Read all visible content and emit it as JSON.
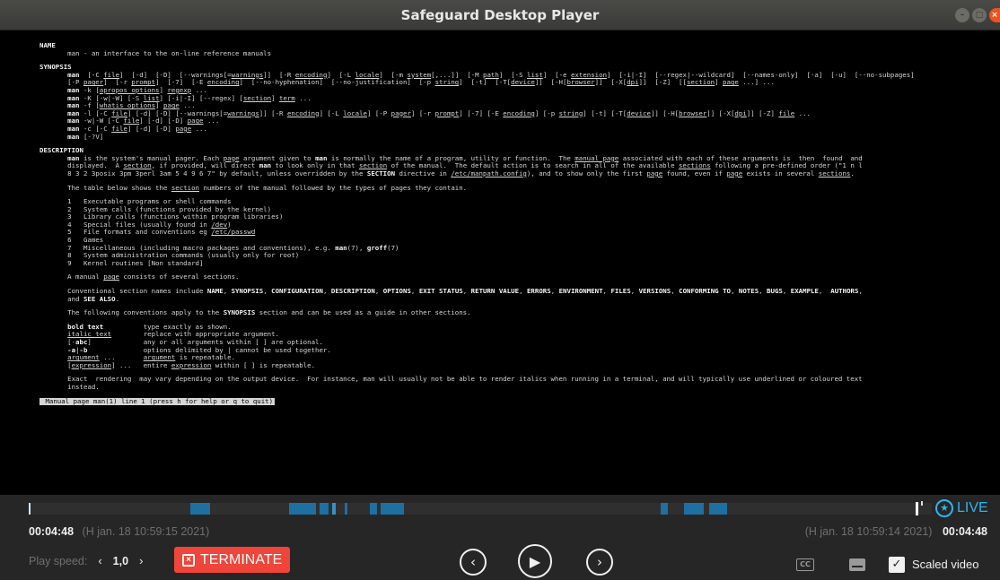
{
  "window": {
    "title": "Safeguard Desktop Player"
  },
  "terminal": {
    "lines": [
      [
        {
          "t": "NAME",
          "c": "b"
        }
      ],
      [
        {
          "t": "       man - an interface to the on-line reference manuals"
        }
      ],
      [],
      [
        {
          "t": "SYNOPSIS",
          "c": "b"
        }
      ],
      [
        {
          "t": "       "
        },
        {
          "t": "man",
          "c": "b"
        },
        {
          "t": "  [-C "
        },
        {
          "t": "file",
          "c": "u"
        },
        {
          "t": "]  [-d]  [-D]  [--warnings[="
        },
        {
          "t": "warnings",
          "c": "u"
        },
        {
          "t": "]]  [-R "
        },
        {
          "t": "encoding",
          "c": "u"
        },
        {
          "t": "]  [-L "
        },
        {
          "t": "locale",
          "c": "u"
        },
        {
          "t": "]  [-m "
        },
        {
          "t": "system",
          "c": "u"
        },
        {
          "t": "[,...]]  [-M "
        },
        {
          "t": "path",
          "c": "u"
        },
        {
          "t": "]  [-S "
        },
        {
          "t": "list",
          "c": "u"
        },
        {
          "t": "]  [-e "
        },
        {
          "t": "extension",
          "c": "u"
        },
        {
          "t": "]  [-i|-I]  [--regex|--wildcard]  [--names-only]  [-a]  [-u]  [--no-subpages]"
        }
      ],
      [
        {
          "t": "       [-P "
        },
        {
          "t": "pager",
          "c": "u"
        },
        {
          "t": "]  [-r "
        },
        {
          "t": "prompt",
          "c": "u"
        },
        {
          "t": "]  [-7]  [-E "
        },
        {
          "t": "encoding",
          "c": "u"
        },
        {
          "t": "]  [--no-hyphenation]  [--no-justification]  [-p "
        },
        {
          "t": "string",
          "c": "u"
        },
        {
          "t": "]  [-t]  [-T["
        },
        {
          "t": "device",
          "c": "u"
        },
        {
          "t": "]]  [-H["
        },
        {
          "t": "browser",
          "c": "u"
        },
        {
          "t": "]]  [-X["
        },
        {
          "t": "dpi",
          "c": "u"
        },
        {
          "t": "]]  [-Z]  [["
        },
        {
          "t": "section",
          "c": "u"
        },
        {
          "t": "] "
        },
        {
          "t": "page",
          "c": "u"
        },
        {
          "t": " ...] ..."
        }
      ],
      [
        {
          "t": "       "
        },
        {
          "t": "man",
          "c": "b"
        },
        {
          "t": " -k ["
        },
        {
          "t": "apropos options",
          "c": "u"
        },
        {
          "t": "] "
        },
        {
          "t": "regexp",
          "c": "u"
        },
        {
          "t": " ..."
        }
      ],
      [
        {
          "t": "       "
        },
        {
          "t": "man",
          "c": "b"
        },
        {
          "t": " -K [-w|-W] [-S "
        },
        {
          "t": "list",
          "c": "u"
        },
        {
          "t": "] [-i|-I] [--regex] ["
        },
        {
          "t": "section",
          "c": "u"
        },
        {
          "t": "] "
        },
        {
          "t": "term",
          "c": "u"
        },
        {
          "t": " ..."
        }
      ],
      [
        {
          "t": "       "
        },
        {
          "t": "man",
          "c": "b"
        },
        {
          "t": " -f ["
        },
        {
          "t": "whatis options",
          "c": "u"
        },
        {
          "t": "] "
        },
        {
          "t": "page",
          "c": "u"
        },
        {
          "t": " ..."
        }
      ],
      [
        {
          "t": "       "
        },
        {
          "t": "man",
          "c": "b"
        },
        {
          "t": " -l [-C "
        },
        {
          "t": "file",
          "c": "u"
        },
        {
          "t": "] [-d] [-D] [--warnings[="
        },
        {
          "t": "warnings",
          "c": "u"
        },
        {
          "t": "]] [-R "
        },
        {
          "t": "encoding",
          "c": "u"
        },
        {
          "t": "] [-L "
        },
        {
          "t": "locale",
          "c": "u"
        },
        {
          "t": "] [-P "
        },
        {
          "t": "pager",
          "c": "u"
        },
        {
          "t": "] [-r "
        },
        {
          "t": "prompt",
          "c": "u"
        },
        {
          "t": "] [-7] [-E "
        },
        {
          "t": "encoding",
          "c": "u"
        },
        {
          "t": "] [-p "
        },
        {
          "t": "string",
          "c": "u"
        },
        {
          "t": "] [-t] [-T["
        },
        {
          "t": "device",
          "c": "u"
        },
        {
          "t": "]] [-H["
        },
        {
          "t": "browser",
          "c": "u"
        },
        {
          "t": "]] [-X["
        },
        {
          "t": "dpi",
          "c": "u"
        },
        {
          "t": "]] [-Z] "
        },
        {
          "t": "file",
          "c": "u"
        },
        {
          "t": " ..."
        }
      ],
      [
        {
          "t": "       "
        },
        {
          "t": "man",
          "c": "b"
        },
        {
          "t": " -w|-W [-C "
        },
        {
          "t": "file",
          "c": "u"
        },
        {
          "t": "] [-d] [-D] "
        },
        {
          "t": "page",
          "c": "u"
        },
        {
          "t": " ..."
        }
      ],
      [
        {
          "t": "       "
        },
        {
          "t": "man",
          "c": "b"
        },
        {
          "t": " -c [-C "
        },
        {
          "t": "file",
          "c": "u"
        },
        {
          "t": "] [-d] [-D] "
        },
        {
          "t": "page",
          "c": "u"
        },
        {
          "t": " ..."
        }
      ],
      [
        {
          "t": "       "
        },
        {
          "t": "man",
          "c": "b"
        },
        {
          "t": " [-?V]"
        }
      ],
      [],
      [
        {
          "t": "DESCRIPTION",
          "c": "b"
        }
      ],
      [
        {
          "t": "       "
        },
        {
          "t": "man",
          "c": "b"
        },
        {
          "t": " is the system's manual pager. Each "
        },
        {
          "t": "page",
          "c": "u"
        },
        {
          "t": " argument given to "
        },
        {
          "t": "man",
          "c": "b"
        },
        {
          "t": " is normally the name of a program, utility or function.  The "
        },
        {
          "t": "manual page",
          "c": "u"
        },
        {
          "t": " associated with each of these arguments is  then  found  and"
        }
      ],
      [
        {
          "t": "       displayed.  A "
        },
        {
          "t": "section",
          "c": "u"
        },
        {
          "t": ", if provided, will direct "
        },
        {
          "t": "man",
          "c": "b"
        },
        {
          "t": " to look only in that "
        },
        {
          "t": "section",
          "c": "u"
        },
        {
          "t": " of the manual.  The default action is to search in all of the available "
        },
        {
          "t": "sections",
          "c": "u"
        },
        {
          "t": " following a pre-defined order (\"1 n l"
        }
      ],
      [
        {
          "t": "       8 3 2 3posix 3pm 3perl 3am 5 4 9 6 7\" by default, unless overridden by the "
        },
        {
          "t": "SECTION",
          "c": "b"
        },
        {
          "t": " directive in "
        },
        {
          "t": "/etc/manpath.config",
          "c": "u"
        },
        {
          "t": "), and to show only the first "
        },
        {
          "t": "page",
          "c": "u"
        },
        {
          "t": " found, even if "
        },
        {
          "t": "page",
          "c": "u"
        },
        {
          "t": " exists in several "
        },
        {
          "t": "sections",
          "c": "u"
        },
        {
          "t": "."
        }
      ],
      [],
      [
        {
          "t": "       The table below shows the "
        },
        {
          "t": "section",
          "c": "u"
        },
        {
          "t": " numbers of the manual followed by the types of pages they contain."
        }
      ],
      [],
      [
        {
          "t": "       1   Executable programs or shell commands"
        }
      ],
      [
        {
          "t": "       2   System calls (functions provided by the kernel)"
        }
      ],
      [
        {
          "t": "       3   Library calls (functions within program libraries)"
        }
      ],
      [
        {
          "t": "       4   Special files (usually found in "
        },
        {
          "t": "/dev",
          "c": "u"
        },
        {
          "t": ")"
        }
      ],
      [
        {
          "t": "       5   File formats and conventions eg "
        },
        {
          "t": "/etc/passwd",
          "c": "u"
        }
      ],
      [
        {
          "t": "       6   Games"
        }
      ],
      [
        {
          "t": "       7   Miscellaneous (including macro packages and conventions), e.g. "
        },
        {
          "t": "man",
          "c": "b"
        },
        {
          "t": "(7), "
        },
        {
          "t": "groff",
          "c": "b"
        },
        {
          "t": "(7)"
        }
      ],
      [
        {
          "t": "       8   System administration commands (usually only for root)"
        }
      ],
      [
        {
          "t": "       9   Kernel routines [Non standard]"
        }
      ],
      [],
      [
        {
          "t": "       A manual "
        },
        {
          "t": "page",
          "c": "u"
        },
        {
          "t": " consists of several sections."
        }
      ],
      [],
      [
        {
          "t": "       Conventional section names include "
        },
        {
          "t": "NAME",
          "c": "b"
        },
        {
          "t": ", "
        },
        {
          "t": "SYNOPSIS",
          "c": "b"
        },
        {
          "t": ", "
        },
        {
          "t": "CONFIGURATION",
          "c": "b"
        },
        {
          "t": ", "
        },
        {
          "t": "DESCRIPTION",
          "c": "b"
        },
        {
          "t": ", "
        },
        {
          "t": "OPTIONS",
          "c": "b"
        },
        {
          "t": ", "
        },
        {
          "t": "EXIT STATUS",
          "c": "b"
        },
        {
          "t": ", "
        },
        {
          "t": "RETURN VALUE",
          "c": "b"
        },
        {
          "t": ", "
        },
        {
          "t": "ERRORS",
          "c": "b"
        },
        {
          "t": ", "
        },
        {
          "t": "ENVIRONMENT",
          "c": "b"
        },
        {
          "t": ", "
        },
        {
          "t": "FILES",
          "c": "b"
        },
        {
          "t": ", "
        },
        {
          "t": "VERSIONS",
          "c": "b"
        },
        {
          "t": ", "
        },
        {
          "t": "CONFORMING TO",
          "c": "b"
        },
        {
          "t": ", "
        },
        {
          "t": "NOTES",
          "c": "b"
        },
        {
          "t": ", "
        },
        {
          "t": "BUGS",
          "c": "b"
        },
        {
          "t": ", "
        },
        {
          "t": "EXAMPLE",
          "c": "b"
        },
        {
          "t": ",  "
        },
        {
          "t": "AUTHORS",
          "c": "b"
        },
        {
          "t": ","
        }
      ],
      [
        {
          "t": "       and "
        },
        {
          "t": "SEE ALSO",
          "c": "b"
        },
        {
          "t": "."
        }
      ],
      [],
      [
        {
          "t": "       The following conventions apply to the "
        },
        {
          "t": "SYNOPSIS",
          "c": "b"
        },
        {
          "t": " section and can be used as a guide in other sections."
        }
      ],
      [],
      [
        {
          "t": "       "
        },
        {
          "t": "bold text",
          "c": "b"
        },
        {
          "t": "          type exactly as shown."
        }
      ],
      [
        {
          "t": "       "
        },
        {
          "t": "italic text",
          "c": "u"
        },
        {
          "t": "        replace with appropriate argument."
        }
      ],
      [
        {
          "t": "       [-"
        },
        {
          "t": "abc",
          "c": "b"
        },
        {
          "t": "]             any or all arguments within [ ] are optional."
        }
      ],
      [
        {
          "t": "       "
        },
        {
          "t": "-a",
          "c": "b"
        },
        {
          "t": "|"
        },
        {
          "t": "-b",
          "c": "b"
        },
        {
          "t": "              options delimited by | cannot be used together."
        }
      ],
      [
        {
          "t": "       "
        },
        {
          "t": "argument",
          "c": "u"
        },
        {
          "t": " ...       "
        },
        {
          "t": "argument",
          "c": "u"
        },
        {
          "t": " is repeatable."
        }
      ],
      [
        {
          "t": "       ["
        },
        {
          "t": "expression",
          "c": "u"
        },
        {
          "t": "] ...   entire "
        },
        {
          "t": "expression",
          "c": "u"
        },
        {
          "t": " within [ ] is repeatable."
        }
      ],
      [],
      [
        {
          "t": "       Exact  rendering  may vary depending on the output device.  For instance, man will usually not be able to render italics when running in a terminal, and will typically use underlined or coloured text"
        }
      ],
      [
        {
          "t": "       instead."
        }
      ],
      [],
      [
        {
          "t": " Manual page man(1) line 1 (press h for help or q to quit)",
          "c": "status"
        }
      ]
    ]
  },
  "player": {
    "live_label": "LIVE",
    "current_time_left": "00:04:48",
    "timestamp_left": "(H jan. 18 10:59:15 2021)",
    "timestamp_right": "(H jan. 18 10:59:14 2021)",
    "current_time_right": "00:04:48",
    "speed_label": "Play speed:",
    "speed_value": "1,0",
    "terminate_label": "TERMINATE",
    "cc_label": "CC",
    "scaled_video_label": "Scaled video",
    "scaled_video_checked": true
  }
}
